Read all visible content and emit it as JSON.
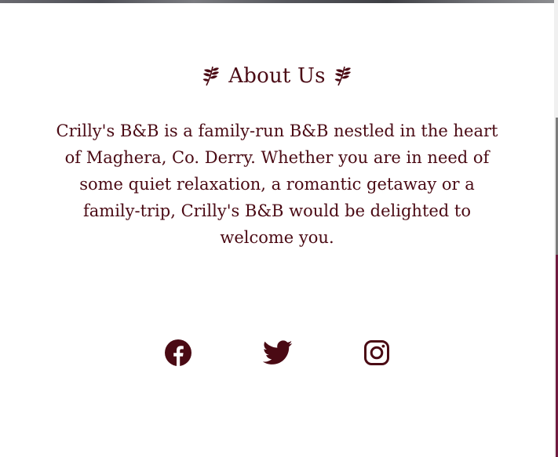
{
  "about": {
    "heading": "About Us",
    "left_ornament_icon": "leaf-sprig-icon",
    "right_ornament_icon": "leaf-sprig-icon",
    "text": "Crilly's B&B is a family-run B&B nestled in the heart of Maghera, Co. Derry. Whether you are in need of some quiet relaxation, a romantic getaway or a family-trip, Crilly's B&B would be delighted to welcome you."
  },
  "social": {
    "links": [
      {
        "icon": "facebook-icon"
      },
      {
        "icon": "twitter-icon"
      },
      {
        "icon": "instagram-icon"
      }
    ]
  },
  "colors": {
    "text": "#4a0a14",
    "background": "#ffffff",
    "accent": "#6f1a3f"
  }
}
